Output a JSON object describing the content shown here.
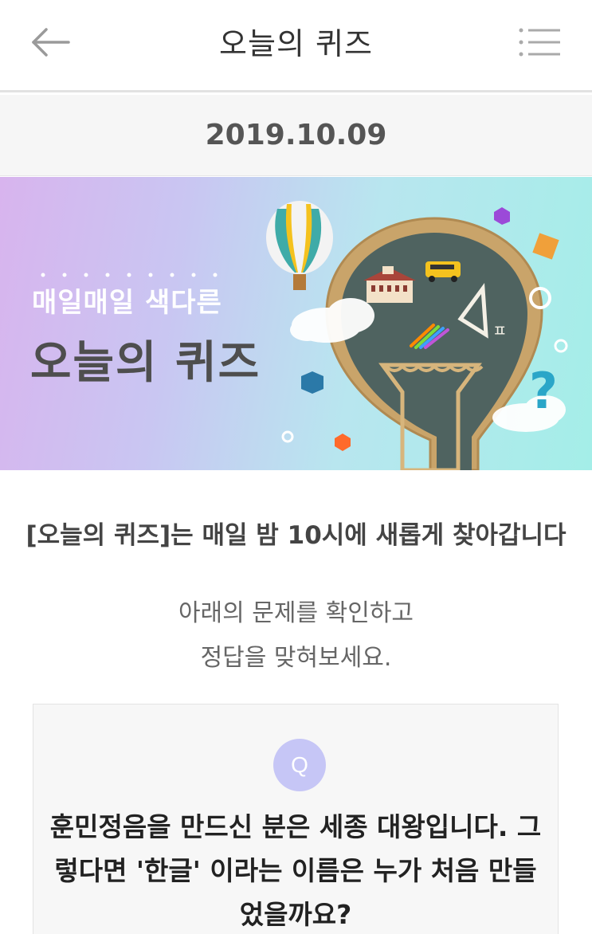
{
  "header": {
    "title": "오늘의 퀴즈",
    "back_icon": "arrow-left-icon",
    "menu_icon": "menu-list-icon"
  },
  "date": "2019.10.09",
  "banner": {
    "subtitle": "매일매일 색다른",
    "title": "오늘의 퀴즈",
    "art_icons": [
      "hot-air-balloon-icon",
      "lightbulb-chalkboard-icon",
      "school-building-icon",
      "school-bus-icon",
      "pencils-icon",
      "triangle-ruler-icon",
      "question-mark-icon",
      "cloud-icon",
      "cube-icon"
    ],
    "colors": {
      "gradient_start": "#d8b4ee",
      "gradient_end": "#a4eee8"
    }
  },
  "intro": {
    "bold_line": "[오늘의 퀴즈]는 매일 밤 10시에 새롭게 찾아갑니다",
    "line1": "아래의 문제를 확인하고",
    "line2": "정답을 맞혀보세요."
  },
  "quiz": {
    "badge": "Q",
    "question": "훈민정음을 만드신 분은 세종 대왕입니다. 그렇다면 '한글' 이라는 이름은 누가 처음 만들었을까요?"
  }
}
